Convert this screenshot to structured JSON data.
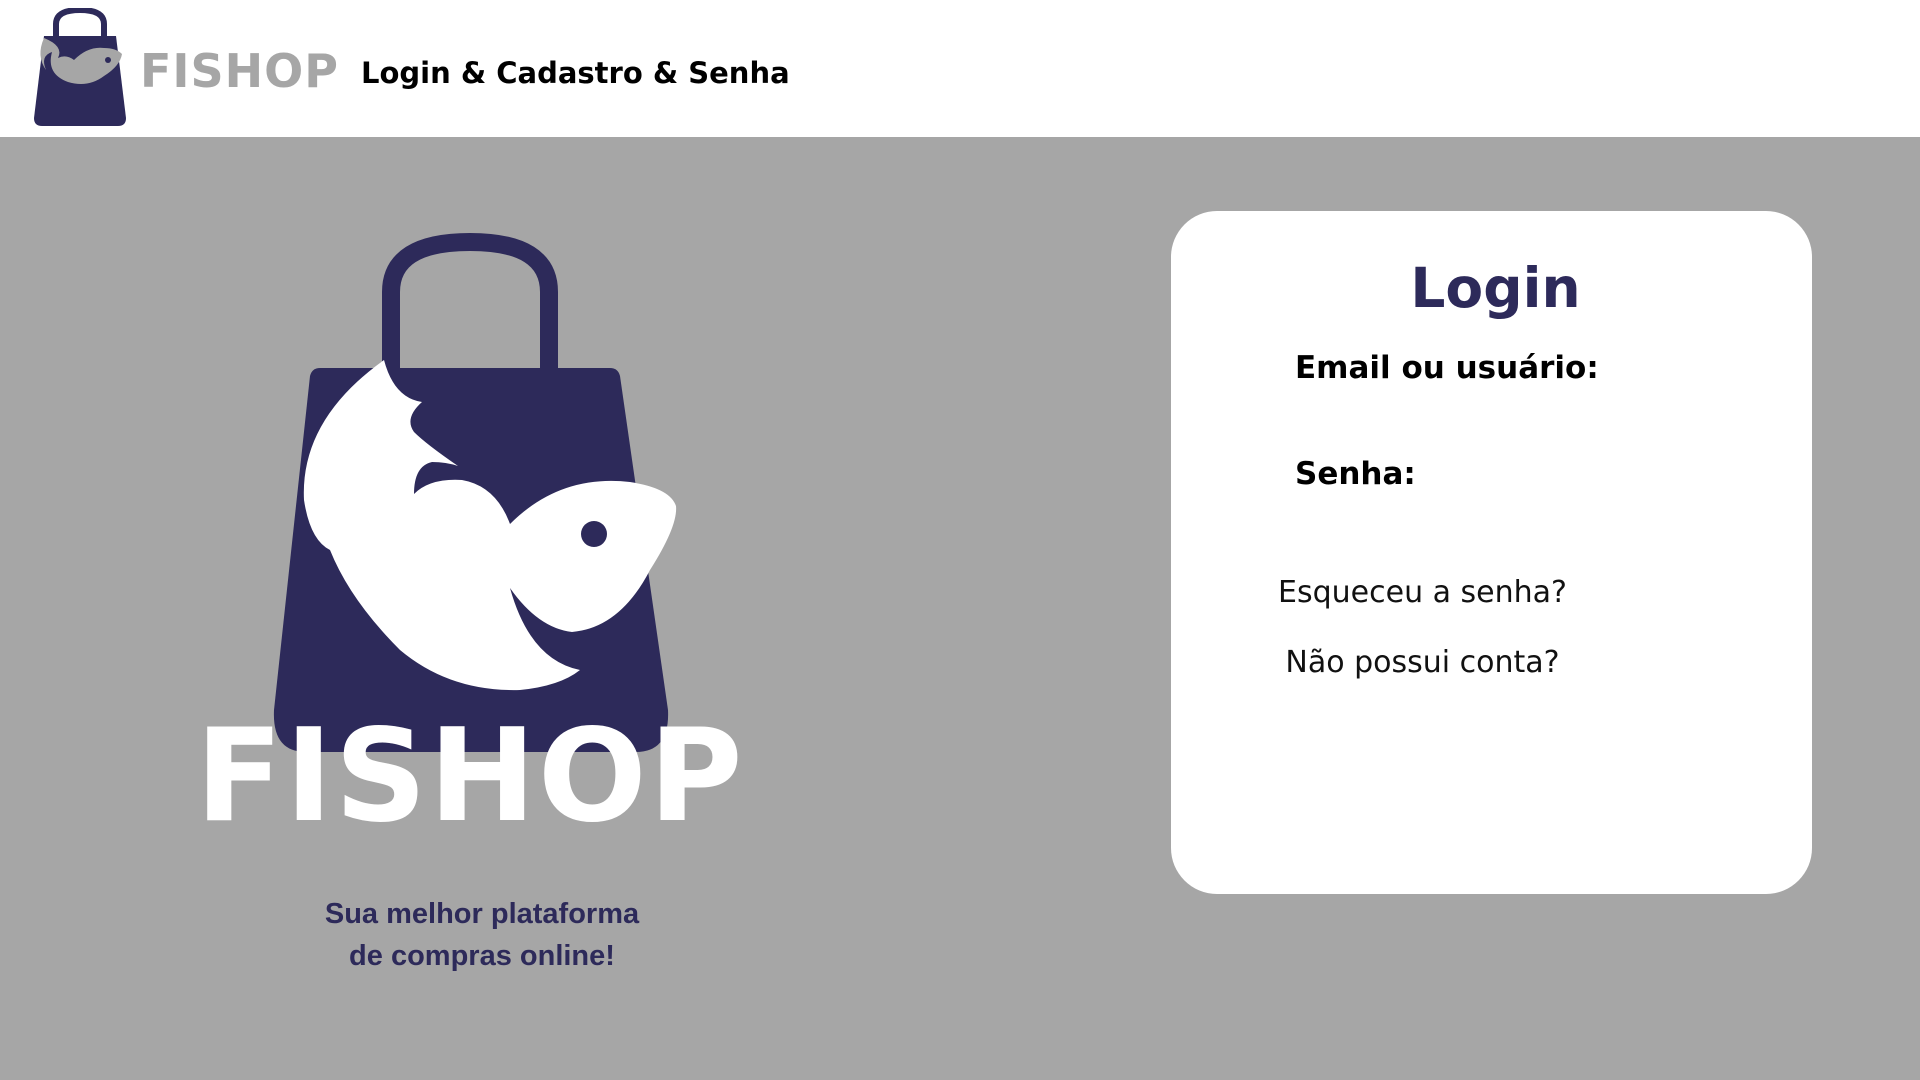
{
  "header": {
    "brand": "FISHOP",
    "subtitle": "Login & Cadastro & Senha"
  },
  "hero": {
    "brand": "FISHOP",
    "tagline_line1": "Sua melhor plataforma",
    "tagline_line2": "de compras online!"
  },
  "login": {
    "title": "Login",
    "email_label": "Email ou usuário:",
    "email_value": "",
    "password_label": "Senha:",
    "password_value": "",
    "forgot_link": "Esqueceu a senha?",
    "signup_link": "Não possui conta?"
  },
  "colors": {
    "background": "#a6a6a6",
    "brand_navy": "#2d2a5a",
    "header_bg": "#ffffff",
    "card_bg": "#ffffff"
  },
  "icons": {
    "logo": "shopping-bag-fish-icon"
  }
}
